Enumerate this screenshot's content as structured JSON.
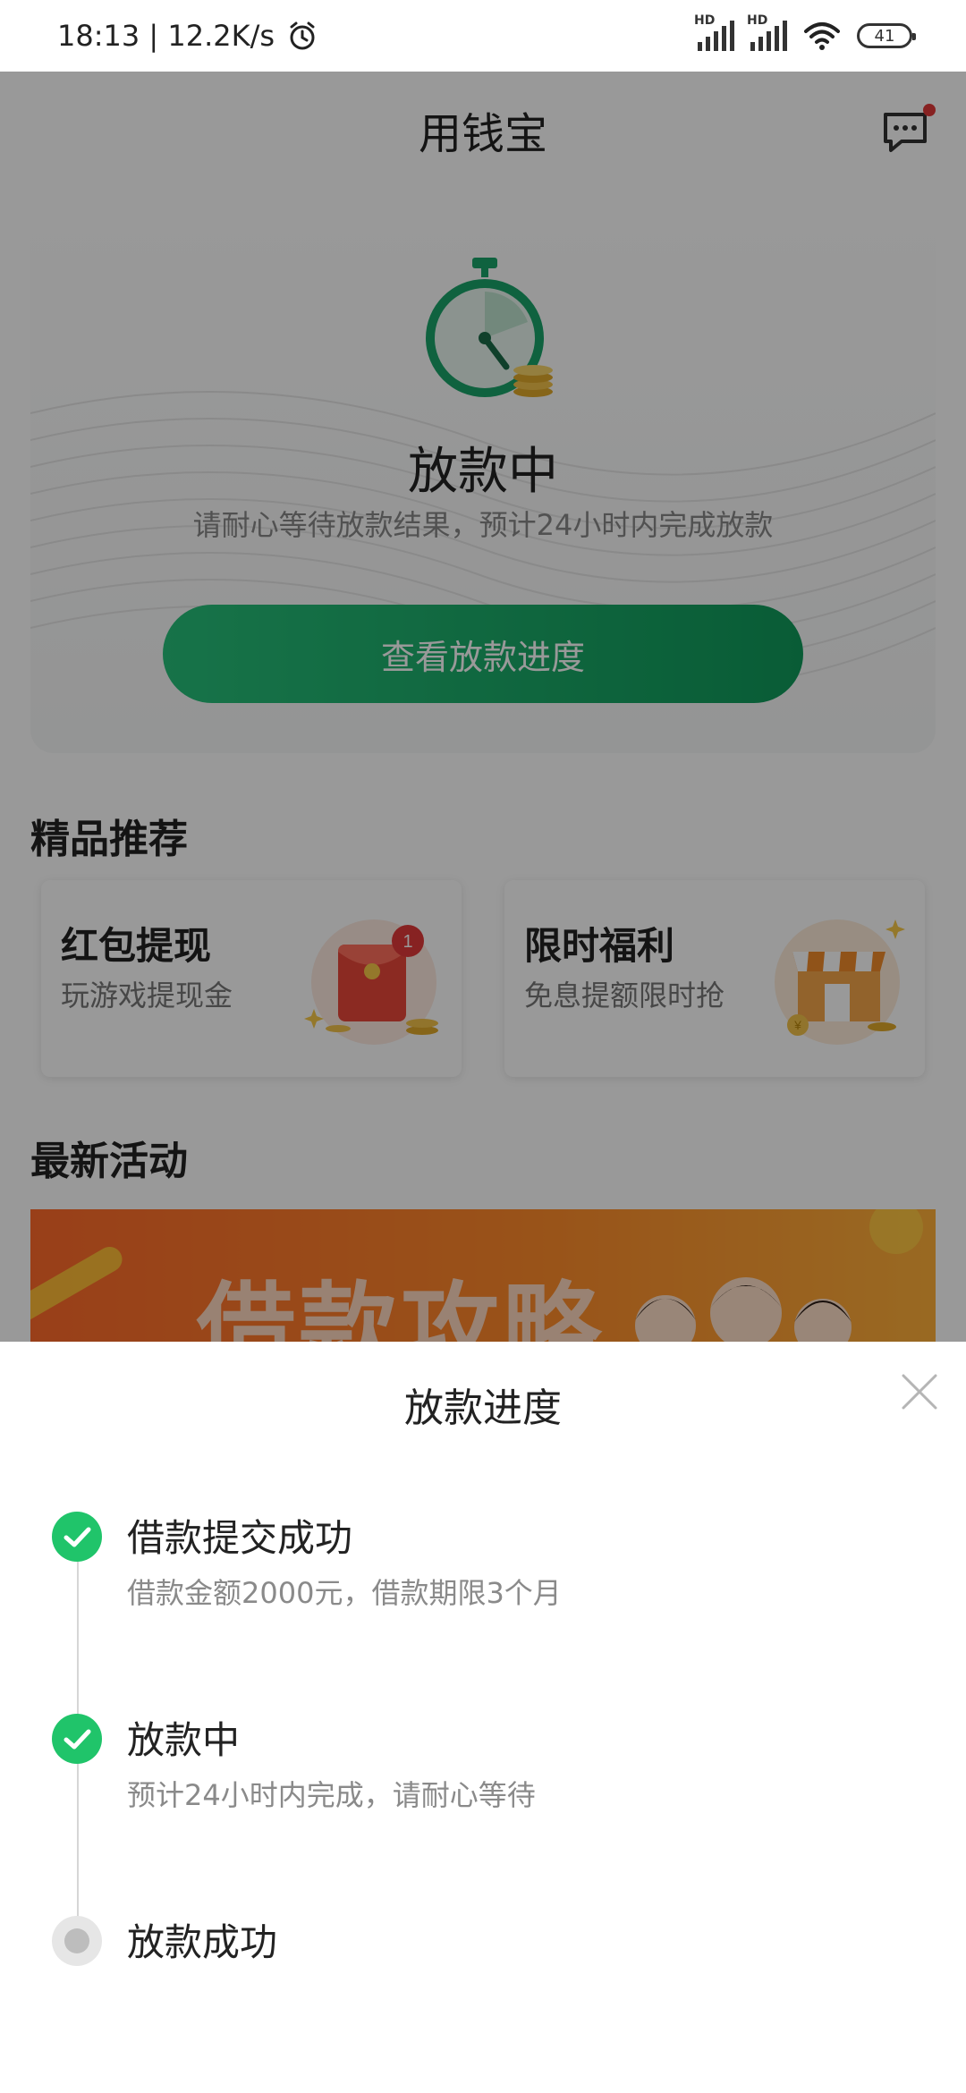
{
  "status_bar": {
    "time_speed": "18:13 | 12.2K/s",
    "battery": "41"
  },
  "header": {
    "title": "用钱宝"
  },
  "status_card": {
    "title": "放款中",
    "subtitle": "请耐心等待放款结果，预计24小时内完成放款",
    "button": "查看放款进度"
  },
  "recommend": {
    "title": "精品推荐",
    "cards": [
      {
        "title": "红包提现",
        "subtitle": "玩游戏提现金",
        "badge": "1"
      },
      {
        "title": "限时福利",
        "subtitle": "免息提额限时抢"
      }
    ]
  },
  "activities": {
    "title": "最新活动",
    "banner_text": "借款攻略"
  },
  "sheet": {
    "title": "放款进度",
    "steps": [
      {
        "title": "借款提交成功",
        "desc": "借款金额2000元，借款期限3个月",
        "state": "done"
      },
      {
        "title": "放款中",
        "desc": "预计24小时内完成，请耐心等待",
        "state": "done"
      },
      {
        "title": "放款成功",
        "desc": "",
        "state": "pending"
      }
    ]
  },
  "colors": {
    "accent": "#20c46a",
    "button_start": "#27c07a",
    "button_end": "#109a5b",
    "banner": "#ff7a2a"
  }
}
